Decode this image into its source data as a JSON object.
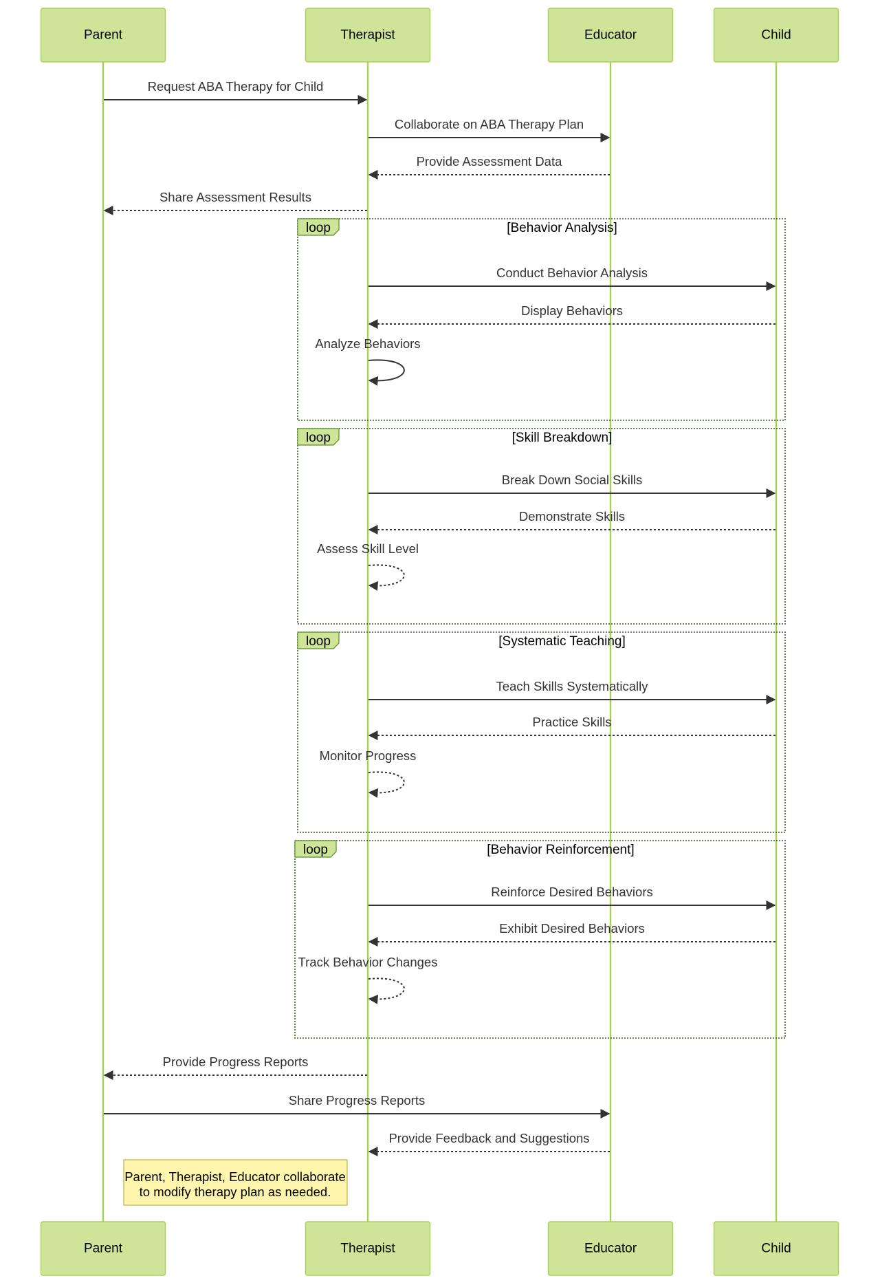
{
  "actors": [
    {
      "id": "parent",
      "label": "Parent"
    },
    {
      "id": "therapist",
      "label": "Therapist"
    },
    {
      "id": "educator",
      "label": "Educator"
    },
    {
      "id": "child",
      "label": "Child"
    }
  ],
  "messages": [
    {
      "from": "parent",
      "to": "therapist",
      "text": "Request ABA Therapy for Child",
      "style": "solid"
    },
    {
      "from": "therapist",
      "to": "educator",
      "text": "Collaborate on ABA Therapy Plan",
      "style": "solid"
    },
    {
      "from": "educator",
      "to": "therapist",
      "text": "Provide Assessment Data",
      "style": "dashed"
    },
    {
      "from": "therapist",
      "to": "parent",
      "text": "Share Assessment Results",
      "style": "dashed"
    },
    {
      "from": "therapist",
      "to": "child",
      "text": "Conduct Behavior Analysis",
      "style": "solid"
    },
    {
      "from": "child",
      "to": "therapist",
      "text": "Display Behaviors",
      "style": "dashed"
    },
    {
      "from": "therapist",
      "to": "therapist",
      "text": "Analyze Behaviors",
      "style": "solid"
    },
    {
      "from": "therapist",
      "to": "child",
      "text": "Break Down Social Skills",
      "style": "solid"
    },
    {
      "from": "child",
      "to": "therapist",
      "text": "Demonstrate Skills",
      "style": "dashed"
    },
    {
      "from": "therapist",
      "to": "therapist",
      "text": "Assess Skill Level",
      "style": "dashed"
    },
    {
      "from": "therapist",
      "to": "child",
      "text": "Teach Skills Systematically",
      "style": "solid"
    },
    {
      "from": "child",
      "to": "therapist",
      "text": "Practice Skills",
      "style": "dashed"
    },
    {
      "from": "therapist",
      "to": "therapist",
      "text": "Monitor Progress",
      "style": "dashed"
    },
    {
      "from": "therapist",
      "to": "child",
      "text": "Reinforce Desired Behaviors",
      "style": "solid"
    },
    {
      "from": "child",
      "to": "therapist",
      "text": "Exhibit Desired Behaviors",
      "style": "dashed"
    },
    {
      "from": "therapist",
      "to": "therapist",
      "text": "Track Behavior Changes",
      "style": "dashed"
    },
    {
      "from": "therapist",
      "to": "parent",
      "text": "Provide Progress Reports",
      "style": "dashed"
    },
    {
      "from": "parent",
      "to": "educator",
      "text": "Share Progress Reports",
      "style": "solid"
    },
    {
      "from": "educator",
      "to": "therapist",
      "text": "Provide Feedback and Suggestions",
      "style": "dashed"
    }
  ],
  "loops": [
    {
      "label": "loop",
      "condition": "[Behavior Analysis]"
    },
    {
      "label": "loop",
      "condition": "[Skill Breakdown]"
    },
    {
      "label": "loop",
      "condition": "[Systematic Teaching]"
    },
    {
      "label": "loop",
      "condition": "[Behavior Reinforcement]"
    }
  ],
  "note": {
    "over": [
      "parent",
      "therapist"
    ],
    "lines": [
      "Parent, Therapist, Educator collaborate",
      "to modify therapy plan as needed."
    ]
  },
  "colors": {
    "actor_fill": "#cee498",
    "lifeline": "#a4d14f",
    "note_fill": "#fff5ad",
    "loop_border": "#2a5a1a"
  }
}
